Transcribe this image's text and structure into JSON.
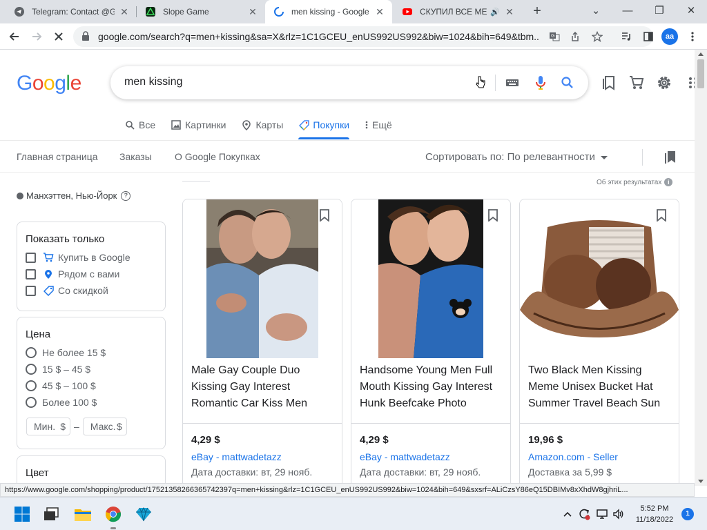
{
  "browser": {
    "tabs": [
      {
        "title": "Telegram: Contact @GI",
        "icon": "telegram-icon"
      },
      {
        "title": "Slope Game",
        "icon": "slope-game-icon"
      },
      {
        "title": "men kissing - Google П",
        "icon": "loading-spinner-icon",
        "active": true
      },
      {
        "title": "СКУПИЛ ВСЕ МЕН",
        "icon": "youtube-icon",
        "audio": true
      }
    ],
    "url": "google.com/search?q=men+kissing&sa=X&rlz=1C1GCEU_enUS992US992&biw=1024&bih=649&tbm...",
    "avatar_initials": "aa"
  },
  "google": {
    "logo": [
      "G",
      "o",
      "o",
      "g",
      "l",
      "e"
    ],
    "logo_colors": [
      "#4285F4",
      "#EA4335",
      "#FBBC05",
      "#4285F4",
      "#34A853",
      "#EA4335"
    ],
    "query": "men kissing",
    "nav_tabs": [
      {
        "label": "Все",
        "icon": "search-icon"
      },
      {
        "label": "Картинки",
        "icon": "image-icon"
      },
      {
        "label": "Карты",
        "icon": "map-pin-icon"
      },
      {
        "label": "Покупки",
        "icon": "tag-icon",
        "active": true
      },
      {
        "label": "Ещё",
        "icon": "more-vert-icon"
      }
    ]
  },
  "shopping_nav": {
    "links": [
      "Главная страница",
      "Заказы",
      "О Google Покупках"
    ],
    "sort_label": "Сортировать по: По релевантности"
  },
  "filters": {
    "location": "Манхэттен, Нью-Йорк",
    "show_only": {
      "title": "Показать только",
      "items": [
        "Купить в Google",
        "Рядом с вами",
        "Со скидкой"
      ]
    },
    "price": {
      "title": "Цена",
      "options": [
        "Не более 15 $",
        "15 $ – 45 $",
        "45 $ – 100 $",
        "Более 100 $"
      ],
      "min_placeholder": "Мин.",
      "max_placeholder": "Макс.",
      "currency": "$",
      "dash": "–"
    },
    "color": {
      "title": "Цвет"
    }
  },
  "results": {
    "about": "Об этих результатах",
    "items": [
      {
        "title": "Male Gay Couple Duo Kissing Gay Interest Romantic Car Kiss Men",
        "price": "4,29 $",
        "store": "eBay",
        "seller": "mattwadetazz",
        "delivery": "Дата доставки: вт, 29 нояб."
      },
      {
        "title": "Handsome Young Men Full Mouth Kissing Gay Interest Hunk Beefcake Photo",
        "price": "4,29 $",
        "store": "eBay",
        "seller": "mattwadetazz",
        "delivery": "Дата доставки: вт, 29 нояб."
      },
      {
        "title": "Two Black Men Kissing Meme Unisex Bucket Hat Summer Travel Beach Sun",
        "price": "19,96 $",
        "store": "Amazon.com",
        "seller": "Seller",
        "delivery": "Доставка за 5,99 $"
      }
    ],
    "seller_separator": "-"
  },
  "status_url": "https://www.google.com/shopping/product/17521358266365742397q=men+kissing&rlz=1C1GCEU_enUS992US992&biw=1024&bih=649&sxsrf=ALiCzsY86eQ15DBIMv8xXhdW8gjhriL...",
  "taskbar": {
    "time": "5:52 PM",
    "date": "11/18/2022",
    "notifications": "1"
  }
}
